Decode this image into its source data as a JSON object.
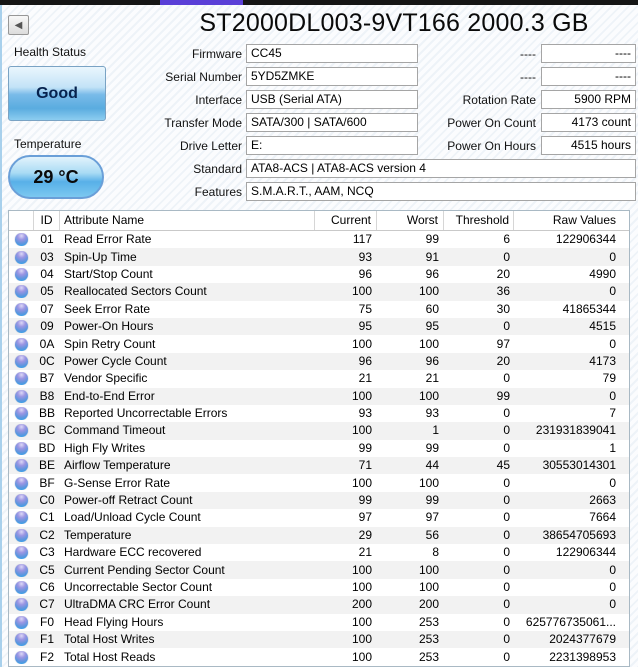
{
  "window": {
    "title": "ST2000DL003-9VT166 2000.3 GB",
    "back_button_glyph": "◀"
  },
  "health": {
    "label": "Health Status",
    "status": "Good"
  },
  "temperature": {
    "label": "Temperature",
    "value": "29 °C"
  },
  "info_left": [
    {
      "label": "Firmware",
      "value": "CC45",
      "wide": false
    },
    {
      "label": "Serial Number",
      "value": "5YD5ZMKE",
      "wide": false
    },
    {
      "label": "Interface",
      "value": "USB (Serial ATA)",
      "wide": false
    },
    {
      "label": "Transfer Mode",
      "value": "SATA/300 | SATA/600",
      "wide": false
    },
    {
      "label": "Drive Letter",
      "value": "E:",
      "wide": false
    },
    {
      "label": "Standard",
      "value": "ATA8-ACS | ATA8-ACS version 4",
      "wide": true
    },
    {
      "label": "Features",
      "value": "S.M.A.R.T., AAM, NCQ",
      "wide": true
    }
  ],
  "info_right": [
    {
      "label": "----",
      "value": "----"
    },
    {
      "label": "----",
      "value": "----"
    },
    {
      "label": "Rotation Rate",
      "value": "5900 RPM"
    },
    {
      "label": "Power On Count",
      "value": "4173 count"
    },
    {
      "label": "Power On Hours",
      "value": "4515 hours"
    }
  ],
  "colors": {
    "accent_bar": "#5a3fd7",
    "health_good_blue": "#79bbe9",
    "status_dot_blue": "#37a0e8"
  },
  "table": {
    "headers": {
      "id": "ID",
      "name": "Attribute Name",
      "current": "Current",
      "worst": "Worst",
      "threshold": "Threshold",
      "raw": "Raw Values"
    },
    "status_icon": "blue-dot-good",
    "rows": [
      {
        "id": "01",
        "name": "Read Error Rate",
        "current": "117",
        "worst": "99",
        "threshold": "6",
        "raw": "122906344"
      },
      {
        "id": "03",
        "name": "Spin-Up Time",
        "current": "93",
        "worst": "91",
        "threshold": "0",
        "raw": "0"
      },
      {
        "id": "04",
        "name": "Start/Stop Count",
        "current": "96",
        "worst": "96",
        "threshold": "20",
        "raw": "4990"
      },
      {
        "id": "05",
        "name": "Reallocated Sectors Count",
        "current": "100",
        "worst": "100",
        "threshold": "36",
        "raw": "0"
      },
      {
        "id": "07",
        "name": "Seek Error Rate",
        "current": "75",
        "worst": "60",
        "threshold": "30",
        "raw": "41865344"
      },
      {
        "id": "09",
        "name": "Power-On Hours",
        "current": "95",
        "worst": "95",
        "threshold": "0",
        "raw": "4515"
      },
      {
        "id": "0A",
        "name": "Spin Retry Count",
        "current": "100",
        "worst": "100",
        "threshold": "97",
        "raw": "0"
      },
      {
        "id": "0C",
        "name": "Power Cycle Count",
        "current": "96",
        "worst": "96",
        "threshold": "20",
        "raw": "4173"
      },
      {
        "id": "B7",
        "name": "Vendor Specific",
        "current": "21",
        "worst": "21",
        "threshold": "0",
        "raw": "79"
      },
      {
        "id": "B8",
        "name": "End-to-End Error",
        "current": "100",
        "worst": "100",
        "threshold": "99",
        "raw": "0"
      },
      {
        "id": "BB",
        "name": "Reported Uncorrectable Errors",
        "current": "93",
        "worst": "93",
        "threshold": "0",
        "raw": "7"
      },
      {
        "id": "BC",
        "name": "Command Timeout",
        "current": "100",
        "worst": "1",
        "threshold": "0",
        "raw": "231931839041"
      },
      {
        "id": "BD",
        "name": "High Fly Writes",
        "current": "99",
        "worst": "99",
        "threshold": "0",
        "raw": "1"
      },
      {
        "id": "BE",
        "name": "Airflow Temperature",
        "current": "71",
        "worst": "44",
        "threshold": "45",
        "raw": "30553014301"
      },
      {
        "id": "BF",
        "name": "G-Sense Error Rate",
        "current": "100",
        "worst": "100",
        "threshold": "0",
        "raw": "0"
      },
      {
        "id": "C0",
        "name": "Power-off Retract Count",
        "current": "99",
        "worst": "99",
        "threshold": "0",
        "raw": "2663"
      },
      {
        "id": "C1",
        "name": "Load/Unload Cycle Count",
        "current": "97",
        "worst": "97",
        "threshold": "0",
        "raw": "7664"
      },
      {
        "id": "C2",
        "name": "Temperature",
        "current": "29",
        "worst": "56",
        "threshold": "0",
        "raw": "38654705693"
      },
      {
        "id": "C3",
        "name": "Hardware ECC recovered",
        "current": "21",
        "worst": "8",
        "threshold": "0",
        "raw": "122906344"
      },
      {
        "id": "C5",
        "name": "Current Pending Sector Count",
        "current": "100",
        "worst": "100",
        "threshold": "0",
        "raw": "0"
      },
      {
        "id": "C6",
        "name": "Uncorrectable Sector Count",
        "current": "100",
        "worst": "100",
        "threshold": "0",
        "raw": "0"
      },
      {
        "id": "C7",
        "name": "UltraDMA CRC Error Count",
        "current": "200",
        "worst": "200",
        "threshold": "0",
        "raw": "0"
      },
      {
        "id": "F0",
        "name": "Head Flying Hours",
        "current": "100",
        "worst": "253",
        "threshold": "0",
        "raw": "625776735061..."
      },
      {
        "id": "F1",
        "name": "Total Host Writes",
        "current": "100",
        "worst": "253",
        "threshold": "0",
        "raw": "2024377679"
      },
      {
        "id": "F2",
        "name": "Total Host Reads",
        "current": "100",
        "worst": "253",
        "threshold": "0",
        "raw": "2231398953"
      }
    ]
  }
}
